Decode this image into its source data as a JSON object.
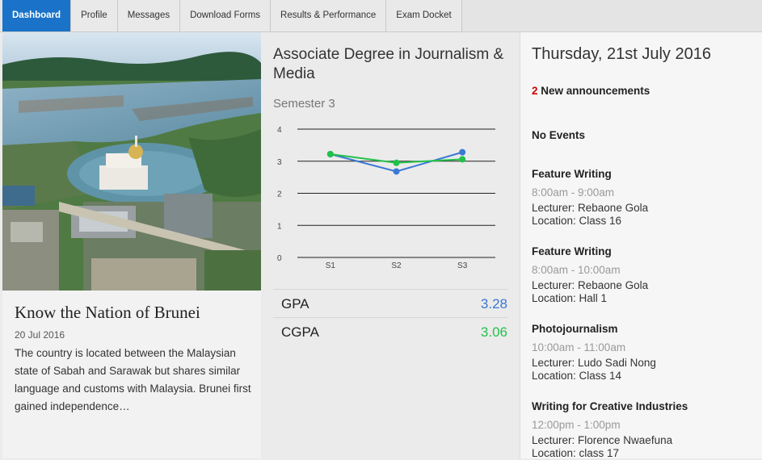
{
  "nav": {
    "tabs": [
      {
        "label": "Dashboard",
        "active": true
      },
      {
        "label": "Profile"
      },
      {
        "label": "Messages"
      },
      {
        "label": "Download Forms"
      },
      {
        "label": "Results & Performance"
      },
      {
        "label": "Exam Docket"
      }
    ]
  },
  "article": {
    "title": "Know the Nation of Brunei",
    "date": "20 Jul 2016",
    "excerpt": "The country is located between the Malaysian state of Sabah and Sarawak but shares similar language and customs with Malaysia. Brunei first gained independence…"
  },
  "program": {
    "name": "Associate Degree in Journalism & Media",
    "semester": "Semester 3"
  },
  "chart_data": {
    "type": "line",
    "categories": [
      "S1",
      "S2",
      "S3"
    ],
    "ylim": [
      0,
      4
    ],
    "yticks": [
      "0",
      "1",
      "2",
      "3",
      "4"
    ],
    "series": [
      {
        "name": "GPA",
        "color": "#3a78d4",
        "values": [
          3.22,
          2.68,
          3.28
        ]
      },
      {
        "name": "CGPA",
        "color": "#22c24a",
        "values": [
          3.22,
          2.95,
          3.06
        ]
      }
    ],
    "grid": true
  },
  "stats": {
    "gpa_label": "GPA",
    "gpa_value": "3.28",
    "gpa_color": "#3a78d4",
    "cgpa_label": "CGPA",
    "cgpa_value": "3.06",
    "cgpa_color": "#22c24a"
  },
  "sidebar": {
    "date": "Thursday, 21st July 2016",
    "announcements_count": "2",
    "announcements_label": "New announcements",
    "no_events": "No Events",
    "events": [
      {
        "name": "Feature Writing",
        "time": "8:00am - 9:00am",
        "lecturer": "Lecturer: Rebaone Gola",
        "location": "Location: Class 16"
      },
      {
        "name": "Feature Writing",
        "time": "8:00am - 10:00am",
        "lecturer": "Lecturer: Rebaone Gola",
        "location": "Location: Hall 1"
      },
      {
        "name": "Photojournalism",
        "time": "10:00am - 11:00am",
        "lecturer": "Lecturer: Ludo Sadi Nong",
        "location": "Location: Class 14"
      },
      {
        "name": "Writing for Creative Industries",
        "time": "12:00pm - 1:00pm",
        "lecturer": "Lecturer: Florence Nwaefuna",
        "location": "Location: class 17"
      }
    ]
  }
}
